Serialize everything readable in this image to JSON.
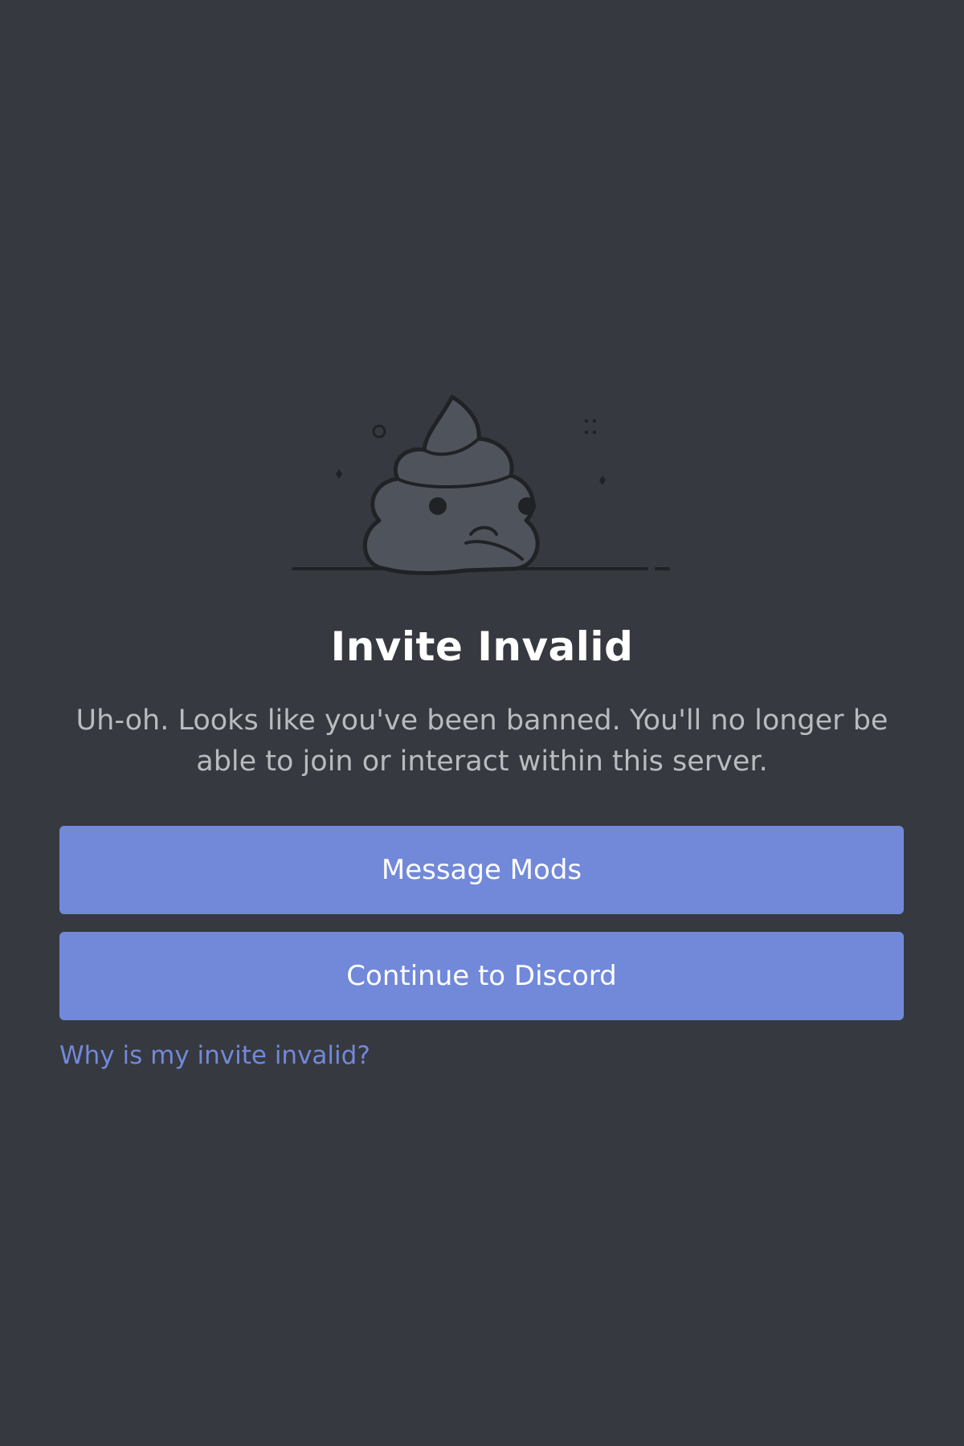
{
  "illustration": {
    "icon": "sad-poop-icon",
    "body_color": "#4f545c",
    "outline_color": "#202225"
  },
  "title": "Invite Invalid",
  "message": "Uh-oh. Looks like you've been banned. You'll no longer be able to join or interact within this server.",
  "buttons": {
    "message_mods": "Message Mods",
    "continue": "Continue to Discord"
  },
  "help_link": "Why is my invite invalid?",
  "colors": {
    "background": "#36393f",
    "accent": "#7289da",
    "title": "#ffffff",
    "body_text": "#b9bbbe"
  }
}
